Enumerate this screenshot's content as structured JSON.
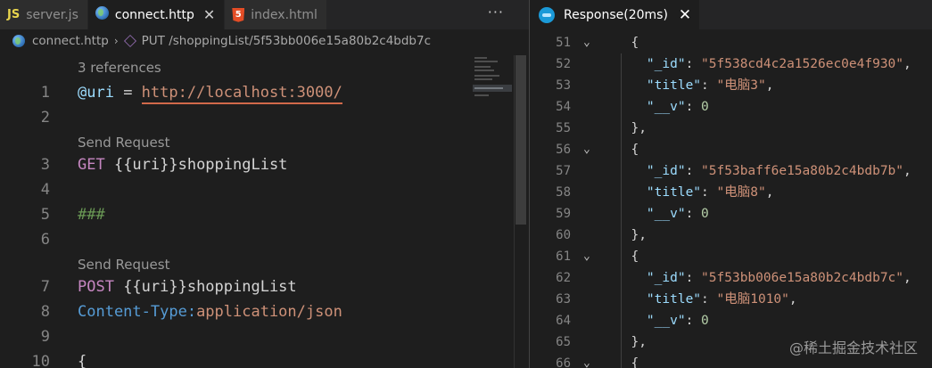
{
  "editor_tabs": [
    {
      "icon": "JS",
      "label": "server.js",
      "active": false
    },
    {
      "label": "connect.http",
      "active": true,
      "close": "✕"
    },
    {
      "icon": "5",
      "label": "index.html",
      "active": false
    }
  ],
  "tab_more": "···",
  "breadcrumb": {
    "file": "connect.http",
    "separator": "›",
    "request": "PUT /shoppingList/5f53bb006e15a80b2c4bdb7c"
  },
  "editor": {
    "lens_references": "3 references",
    "lens_send": "Send Request",
    "lines": {
      "l1": {
        "num": "1",
        "var": "@uri",
        "op": " = ",
        "url": "http://localhost:3000/"
      },
      "l2": {
        "num": "2"
      },
      "l3": {
        "num": "3",
        "method": "GET",
        "rest": " {{uri}}shoppingList"
      },
      "l4": {
        "num": "4"
      },
      "l5": {
        "num": "5",
        "comment": "###"
      },
      "l6": {
        "num": "6"
      },
      "l7": {
        "num": "7",
        "method": "POST",
        "rest": " {{uri}}shoppingList"
      },
      "l8": {
        "num": "8",
        "header": "Content-Type:",
        "value": "application/json"
      },
      "l9": {
        "num": "9"
      },
      "l10": {
        "num": "10",
        "text": "{"
      }
    }
  },
  "response": {
    "tab_label": "Response(20ms)",
    "close": "✕",
    "fold": "⌄",
    "lines": [
      {
        "num": "51",
        "fold": true,
        "text": "  {"
      },
      {
        "num": "52",
        "key": "\"_id\"",
        "val": "\"5f538cd4c2a1526ec0e4f930\"",
        "tail": ","
      },
      {
        "num": "53",
        "key": "\"title\"",
        "val": "\"电脑3\"",
        "tail": ","
      },
      {
        "num": "54",
        "key": "\"__v\"",
        "num_val": "0"
      },
      {
        "num": "55",
        "text": "  },"
      },
      {
        "num": "56",
        "fold": true,
        "text": "  {"
      },
      {
        "num": "57",
        "key": "\"_id\"",
        "val": "\"5f53baff6e15a80b2c4bdb7b\"",
        "tail": ","
      },
      {
        "num": "58",
        "key": "\"title\"",
        "val": "\"电脑8\"",
        "tail": ","
      },
      {
        "num": "59",
        "key": "\"__v\"",
        "num_val": "0"
      },
      {
        "num": "60",
        "text": "  },"
      },
      {
        "num": "61",
        "fold": true,
        "text": "  {"
      },
      {
        "num": "62",
        "key": "\"_id\"",
        "val": "\"5f53bb006e15a80b2c4bdb7c\"",
        "tail": ","
      },
      {
        "num": "63",
        "key": "\"title\"",
        "val": "\"电脑1010\"",
        "tail": ","
      },
      {
        "num": "64",
        "key": "\"__v\"",
        "num_val": "0"
      },
      {
        "num": "65",
        "text": "  },"
      },
      {
        "num": "66",
        "fold": true,
        "text": "  {"
      }
    ]
  },
  "watermark": "@稀土掘金技术社区",
  "colors": {
    "background": "#1e1e1e",
    "keyword": "#c586c0",
    "string": "#ce9178",
    "variable": "#9cdcfe",
    "comment": "#6a9955",
    "header": "#569cd6",
    "number": "#b5cea8"
  }
}
